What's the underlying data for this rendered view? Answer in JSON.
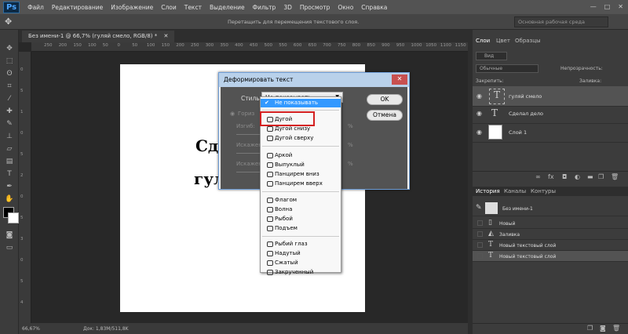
{
  "menubar": {
    "logo": "Ps",
    "items": [
      "Файл",
      "Редактирование",
      "Изображение",
      "Слои",
      "Текст",
      "Выделение",
      "Фильтр",
      "3D",
      "Просмотр",
      "Окно",
      "Справка"
    ]
  },
  "options": {
    "hint": "Перетащить для перемещения текстового слоя.",
    "workspace": "Основная рабочая среда"
  },
  "document": {
    "tab": "Без имени-1 @ 66,7% (гуляй смело, RGB/8) *",
    "text_line1": "Сде",
    "text_line2": "гул",
    "ruler_top": [
      "250",
      "200",
      "150",
      "100",
      "50",
      "0",
      "50",
      "100",
      "150",
      "200",
      "250",
      "300",
      "350",
      "400",
      "450",
      "500",
      "550",
      "600",
      "650",
      "700",
      "750",
      "800",
      "850",
      "900",
      "950",
      "1000",
      "1050",
      "1100",
      "1150",
      "1200"
    ],
    "ruler_left": [
      "0",
      "5",
      "1",
      "0",
      "5",
      "2",
      "0",
      "5",
      "3",
      "0",
      "5",
      "4"
    ],
    "zoom": "66,67%",
    "doc_size": "Док: 1,83M/511,8K"
  },
  "dialog": {
    "title": "Деформировать текст",
    "style_label": "Стиль:",
    "style_value": "Не показывать",
    "ok": "OK",
    "cancel": "Отмена",
    "horizontal_label": "Гориз",
    "bend_label": "Изгиб:",
    "h_distort_label": "Искажен",
    "v_distort_label": "Искажен",
    "pct1": "%",
    "pct2": "%",
    "pct3": "%"
  },
  "dropdown": {
    "selected": "Не показывать",
    "groups": [
      [
        "Дугой",
        "Дугой снизу",
        "Дугой сверху"
      ],
      [
        "Аркой",
        "Выпуклый",
        "Панцирем вниз",
        "Панцирем вверх"
      ],
      [
        "Флагом",
        "Волна",
        "Рыбой",
        "Подъем"
      ],
      [
        "Рыбий глаз",
        "Надутый",
        "Сжатый",
        "Закрученный"
      ]
    ]
  },
  "layers_panel": {
    "tabs": [
      "Слои",
      "Цвет",
      "Образцы"
    ],
    "kind": "Вид",
    "blend": "Обычные",
    "opacity_label": "Непрозрачность:",
    "lock_label": "Закрепить:",
    "fill_label": "Заливка:",
    "layers": [
      "гуляй смело",
      "Сделал дело",
      "Слой 1"
    ]
  },
  "history_panel": {
    "tabs": [
      "История",
      "Каналы",
      "Контуры"
    ],
    "snapshot": "Без имени-1",
    "items": [
      "Новый",
      "Заливка",
      "Новый текстовый слой",
      "Новый текстовый слой"
    ]
  }
}
